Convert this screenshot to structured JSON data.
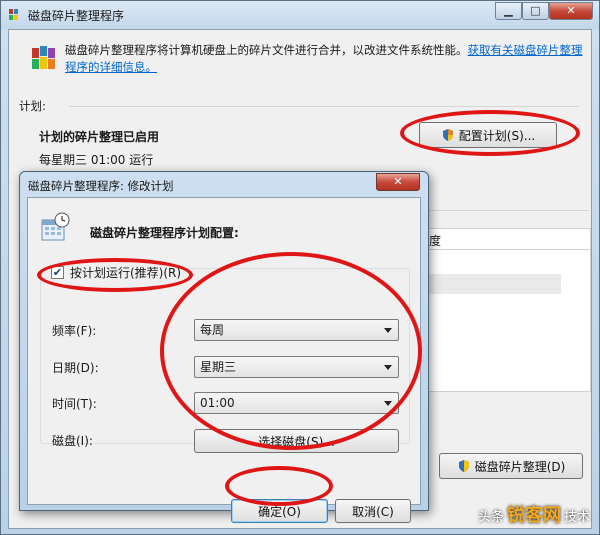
{
  "main": {
    "title": "磁盘碎片整理程序",
    "description": "磁盘碎片整理程序将计算机硬盘上的碎片文件进行合并，以改进文件系统性能。",
    "help_link": "获取有关磁盘碎片整理程序的详细信息。",
    "schedule_section": "计划:",
    "schedule_status": "计划的碎片整理已启用",
    "schedule_time": "每星期三 01:00 运行",
    "configure_button": "配置计划(S)...",
    "status_column": "度",
    "defrag_button": "磁盘碎片整理(D)"
  },
  "dialog": {
    "title": "磁盘碎片整理程序: 修改计划",
    "close_label": "✕",
    "heading": "磁盘碎片整理程序计划配置:",
    "run_on_schedule": "按计划运行(推荐)(R)",
    "run_on_schedule_checked": true,
    "frequency_label": "频率(F):",
    "frequency_value": "每周",
    "day_label": "日期(D):",
    "day_value": "星期三",
    "time_label": "时间(T):",
    "time_value": "01:00",
    "disk_label": "磁盘(I):",
    "select_disk_button": "选择磁盘(S)...",
    "ok_button": "确定(O)",
    "cancel_button": "取消(C)"
  },
  "watermark": {
    "prefix": "头条",
    "logo": "锐客网",
    "suffix": "技术"
  },
  "colors": {
    "highlight": "#e01616",
    "link": "#0066cc"
  }
}
